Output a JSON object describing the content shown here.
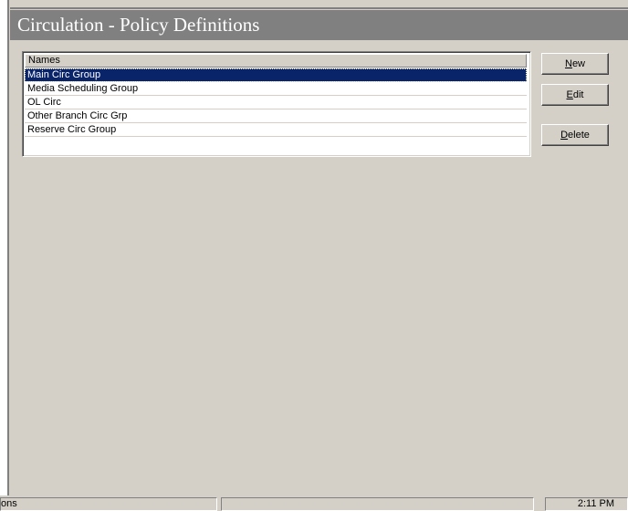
{
  "window": {
    "title": "Circulation - Policy Definitions"
  },
  "list": {
    "column_header": "Names",
    "rows": [
      {
        "label": "Main Circ Group",
        "selected": true
      },
      {
        "label": "Media Scheduling Group",
        "selected": false
      },
      {
        "label": "OL Circ",
        "selected": false
      },
      {
        "label": "Other Branch Circ Grp",
        "selected": false
      },
      {
        "label": "Reserve Circ Group",
        "selected": false
      }
    ]
  },
  "buttons": {
    "new": {
      "accel": "N",
      "rest": "ew"
    },
    "edit": {
      "accel": "E",
      "rest": "dit"
    },
    "delete": {
      "accel": "D",
      "rest": "elete"
    }
  },
  "status": {
    "left": "nitions",
    "middle": "",
    "time": "2:11 PM"
  },
  "colors": {
    "selection": "#0a246a",
    "titlebar": "#808080",
    "face": "#d4d0c8"
  }
}
